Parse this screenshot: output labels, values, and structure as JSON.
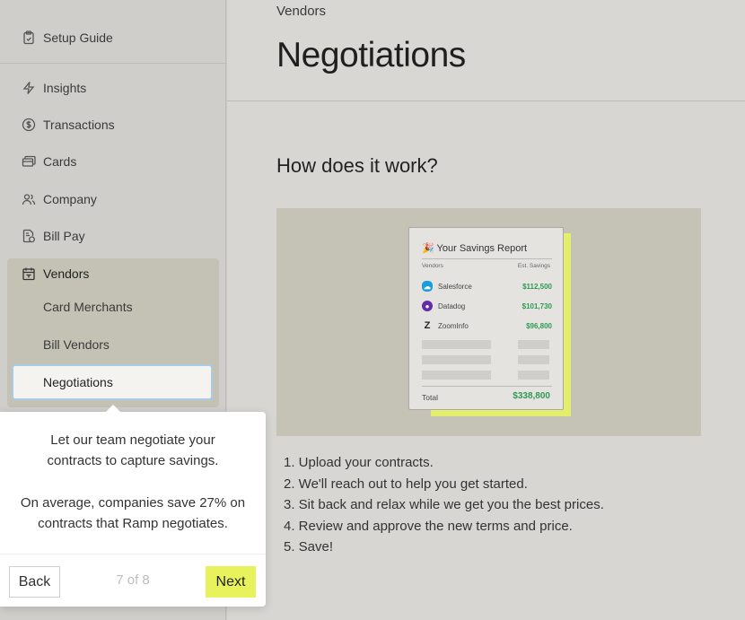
{
  "sidebar": {
    "setup_guide": "Setup Guide",
    "items": [
      {
        "label": "Insights",
        "icon": "lightning-icon"
      },
      {
        "label": "Transactions",
        "icon": "dollar-circle-icon"
      },
      {
        "label": "Cards",
        "icon": "cards-icon"
      },
      {
        "label": "Company",
        "icon": "people-icon"
      },
      {
        "label": "Bill Pay",
        "icon": "bill-icon"
      },
      {
        "label": "Vendors",
        "icon": "vendors-icon"
      }
    ],
    "vendor_subitems": [
      "Card Merchants",
      "Bill Vendors",
      "Negotiations"
    ]
  },
  "header": {
    "breadcrumb": "Vendors",
    "title": "Negotiations"
  },
  "main": {
    "section_title": "How does it work?",
    "report": {
      "title": "🎉 Your Savings Report",
      "col_vendors": "Vendors",
      "col_savings": "Est. Savings",
      "rows": [
        {
          "name": "Salesforce",
          "amount": "$112,500"
        },
        {
          "name": "Datadog",
          "amount": "$101,730"
        },
        {
          "name": "ZoomInfo",
          "amount": "$96,800"
        }
      ],
      "total_label": "Total",
      "total_amount": "$338,800"
    },
    "steps": [
      "1. Upload your contracts.",
      "2. We'll reach out to help you get started.",
      "3. Sit back and relax while we get you the best prices.",
      "4. Review and approve the new terms and price.",
      "5. Save!"
    ]
  },
  "tooltip": {
    "line1": "Let our team negotiate your contracts to capture savings.",
    "line2": "On average, companies save 27% on contracts that Ramp negotiates.",
    "back_label": "Back",
    "pager": "7 of 8",
    "next_label": "Next"
  },
  "colors": {
    "accent": "#e7f25c",
    "savings_green": "#2f9a53",
    "focus_ring": "#a9cbe6"
  }
}
